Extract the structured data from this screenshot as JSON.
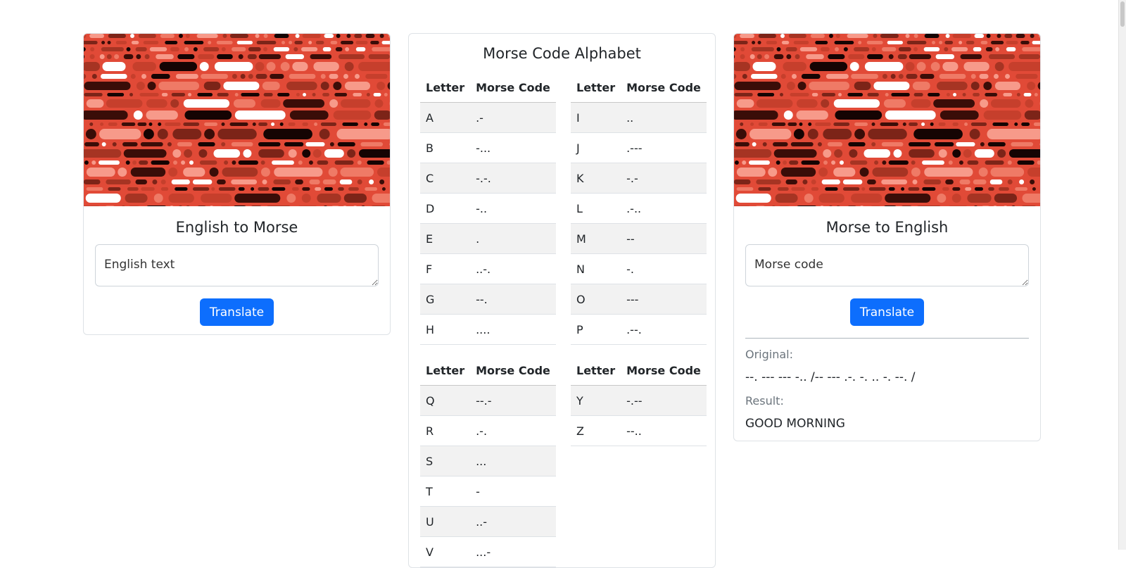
{
  "left_card": {
    "title": "English to Morse",
    "input_placeholder": "English text",
    "button_label": "Translate"
  },
  "middle_card": {
    "title": "Morse Code Alphabet",
    "header_letter": "Letter",
    "header_code": "Morse Code",
    "tables": [
      {
        "rows": [
          [
            "A",
            ".-"
          ],
          [
            "B",
            "-..."
          ],
          [
            "C",
            "-.-."
          ],
          [
            "D",
            "-.."
          ],
          [
            "E",
            "."
          ],
          [
            "F",
            "..-."
          ],
          [
            "G",
            "--."
          ],
          [
            "H",
            "...."
          ]
        ]
      },
      {
        "rows": [
          [
            "I",
            ".."
          ],
          [
            "J",
            ".---"
          ],
          [
            "K",
            "-.-"
          ],
          [
            "L",
            ".-.."
          ],
          [
            "M",
            "--"
          ],
          [
            "N",
            "-."
          ],
          [
            "O",
            "---"
          ],
          [
            "P",
            ".--."
          ]
        ]
      },
      {
        "rows": [
          [
            "Q",
            "--.-"
          ],
          [
            "R",
            ".-."
          ],
          [
            "S",
            "..."
          ],
          [
            "T",
            "-"
          ],
          [
            "U",
            "..-"
          ],
          [
            "V",
            "...-"
          ]
        ]
      },
      {
        "rows": [
          [
            "Y",
            "-.--"
          ],
          [
            "Z",
            "--.."
          ]
        ]
      }
    ]
  },
  "right_card": {
    "title": "Morse to English",
    "input_placeholder": "Morse code",
    "button_label": "Translate",
    "original_label": "Original:",
    "original_value": "--. --- --- -.. /-- --- .-. -. .. -. --. /",
    "result_label": "Result:",
    "result_value": "GOOD MORNING"
  },
  "colors": {
    "primary_button": "#0d6efd",
    "banner_background": "#e14a37",
    "muted_label": "#6c757d"
  },
  "icons": {
    "banner": "morse-pattern-banner"
  }
}
